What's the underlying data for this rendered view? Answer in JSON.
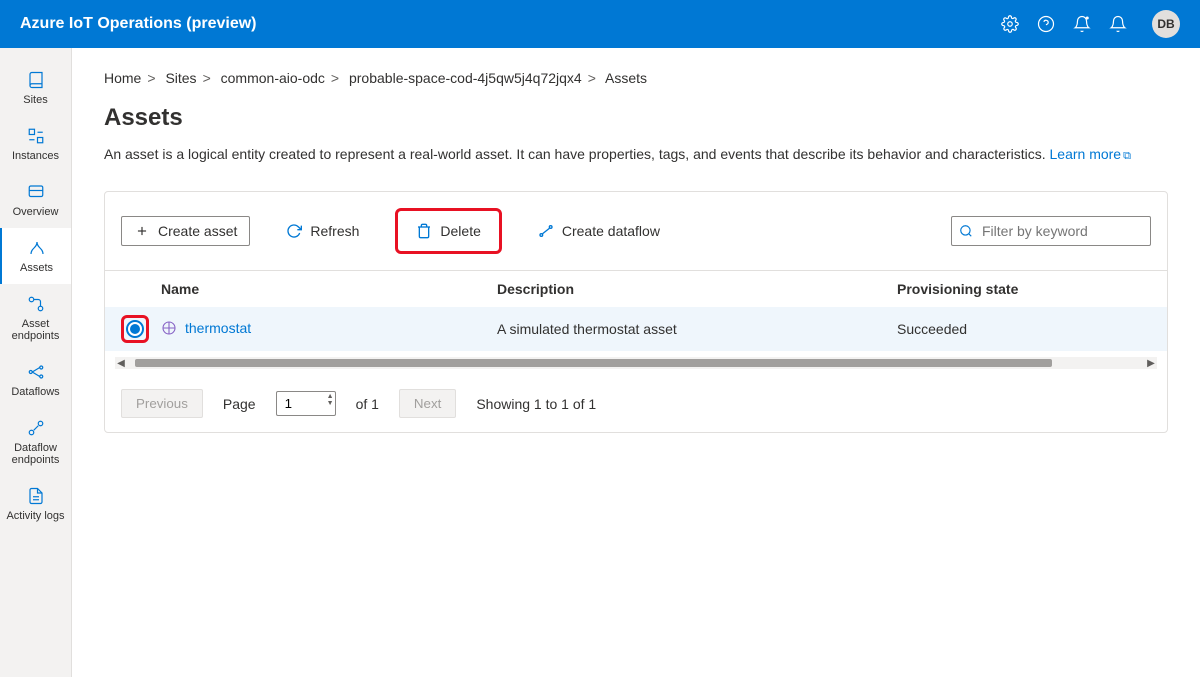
{
  "header": {
    "title": "Azure IoT Operations (preview)",
    "avatar": "DB"
  },
  "sidebar": {
    "items": [
      {
        "label": "Sites"
      },
      {
        "label": "Instances"
      },
      {
        "label": "Overview"
      },
      {
        "label": "Assets"
      },
      {
        "label": "Asset endpoints"
      },
      {
        "label": "Dataflows"
      },
      {
        "label": "Dataflow endpoints"
      },
      {
        "label": "Activity logs"
      }
    ]
  },
  "breadcrumb": {
    "items": [
      "Home",
      "Sites",
      "common-aio-odc",
      "probable-space-cod-4j5qw5j4q72jqx4",
      "Assets"
    ]
  },
  "page": {
    "title": "Assets",
    "description": "An asset is a logical entity created to represent a real-world asset. It can have properties, tags, and events that describe its behavior and characteristics.",
    "learn_more": "Learn more"
  },
  "toolbar": {
    "create": "Create asset",
    "refresh": "Refresh",
    "delete": "Delete",
    "create_dataflow": "Create dataflow",
    "filter_placeholder": "Filter by keyword"
  },
  "table": {
    "headers": {
      "name": "Name",
      "description": "Description",
      "state": "Provisioning state"
    },
    "rows": [
      {
        "name": "thermostat",
        "description": "A simulated thermostat asset",
        "state": "Succeeded"
      }
    ]
  },
  "pager": {
    "previous": "Previous",
    "next": "Next",
    "page_label": "Page",
    "page_value": "1",
    "of_label": "of 1",
    "showing": "Showing 1 to 1 of 1"
  }
}
